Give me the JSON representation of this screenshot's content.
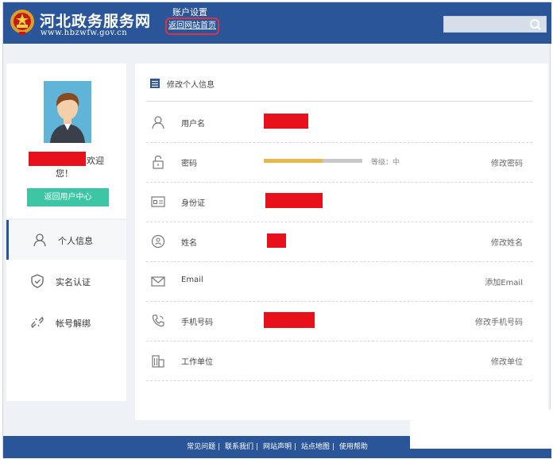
{
  "header": {
    "site_name": "河北政务服务网",
    "site_url": "www.hbzwfw.gov.cn",
    "account_title": "账户设置",
    "back_home_label": "返回网站首页"
  },
  "profile": {
    "welcome_suffix": "欢迎",
    "welcome_line2": "您！",
    "user_center_label": "返回用户中心"
  },
  "nav": {
    "items": [
      {
        "label": "个人信息",
        "active": true
      },
      {
        "label": "实名认证",
        "active": false
      },
      {
        "label": "帐号解绑",
        "active": false
      }
    ]
  },
  "main": {
    "title": "修改个人信息",
    "rows": {
      "username": {
        "label": "用户名"
      },
      "password": {
        "label": "密码",
        "level": "等级：中",
        "strength": 0.6,
        "action": "修改密码"
      },
      "idcard": {
        "label": "身份证"
      },
      "name": {
        "label": "姓名",
        "action": "修改姓名"
      },
      "email": {
        "label": "Email",
        "action": "添加Email"
      },
      "phone": {
        "label": "手机号码",
        "action": "修改手机号码"
      },
      "work": {
        "label": "工作单位",
        "action": "修改单位"
      }
    }
  },
  "footer": {
    "links": [
      "常见问题",
      "联系我们",
      "网站声明",
      "站点地图",
      "使用帮助"
    ]
  },
  "colors": {
    "header_bg": "#2a5699",
    "accent_green": "#3cc6a4",
    "redaction": "#e8101a",
    "strength": "#e8b84a"
  }
}
